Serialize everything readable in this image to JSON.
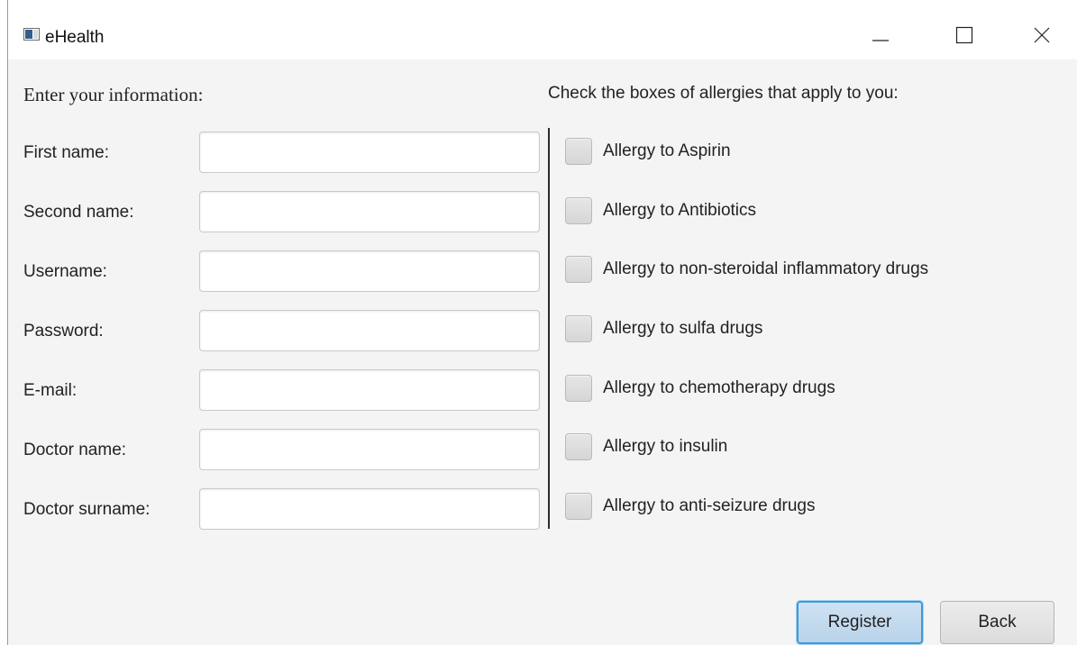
{
  "window": {
    "title": "eHealth",
    "icons": {
      "app": "app-window-icon",
      "minimize": "minimize-icon",
      "maximize": "maximize-icon",
      "close": "close-icon"
    }
  },
  "form": {
    "heading": "Enter your information:",
    "fields": [
      {
        "label": "First name:",
        "value": "",
        "placeholder": ""
      },
      {
        "label": "Second name:",
        "value": "",
        "placeholder": ""
      },
      {
        "label": "Username:",
        "value": "",
        "placeholder": ""
      },
      {
        "label": "Password:",
        "value": "",
        "placeholder": ""
      },
      {
        "label": "E-mail:",
        "value": "",
        "placeholder": ""
      },
      {
        "label": "Doctor name:",
        "value": "",
        "placeholder": ""
      },
      {
        "label": "Doctor surname:",
        "value": "",
        "placeholder": ""
      }
    ]
  },
  "allergies": {
    "heading": "Check the boxes of allergies that apply to you:",
    "items": [
      {
        "label": "Allergy to Aspirin",
        "checked": false
      },
      {
        "label": "Allergy to Antibiotics",
        "checked": false
      },
      {
        "label": "Allergy to non-steroidal inflammatory drugs",
        "checked": false
      },
      {
        "label": "Allergy to sulfa drugs",
        "checked": false
      },
      {
        "label": "Allergy to chemotherapy drugs",
        "checked": false
      },
      {
        "label": "Allergy to insulin",
        "checked": false
      },
      {
        "label": "Allergy to anti-seizure drugs",
        "checked": false
      }
    ]
  },
  "buttons": {
    "register": "Register",
    "back": "Back"
  },
  "colors": {
    "focus_accent": "#3d9ad8",
    "panel_background": "#f4f4f4"
  }
}
